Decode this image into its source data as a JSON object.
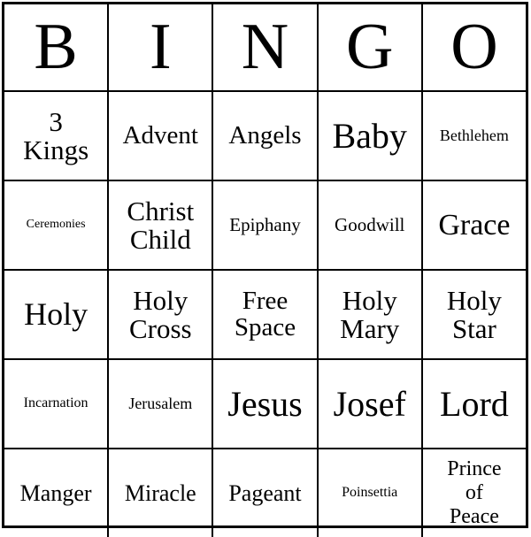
{
  "card": {
    "type": "bingo-card",
    "theme": "Christmas",
    "columns": 5,
    "rows": 5,
    "header": {
      "letters": [
        "B",
        "I",
        "N",
        "G",
        "O"
      ]
    },
    "grid": [
      [
        {
          "text": "3\nKings",
          "lines": [
            "3",
            "Kings"
          ],
          "size": "ml"
        },
        {
          "text": "Advent",
          "lines": [
            "Advent"
          ],
          "size": "md"
        },
        {
          "text": "Angels",
          "lines": [
            "Angels"
          ],
          "size": "md"
        },
        {
          "text": "Baby",
          "lines": [
            "Baby"
          ],
          "size": "xxl"
        },
        {
          "text": "Bethlehem",
          "lines": [
            "Bethlehem"
          ],
          "size": "tiny"
        }
      ],
      [
        {
          "text": "Ceremonies",
          "lines": [
            "Ceremonies"
          ],
          "size": "nano"
        },
        {
          "text": "Christ\nChild",
          "lines": [
            "Christ",
            "Child"
          ],
          "size": "ml"
        },
        {
          "text": "Epiphany",
          "lines": [
            "Epiphany"
          ],
          "size": "xxs"
        },
        {
          "text": "Goodwill",
          "lines": [
            "Goodwill"
          ],
          "size": "xxs"
        },
        {
          "text": "Grace",
          "lines": [
            "Grace"
          ],
          "size": "lg"
        }
      ],
      [
        {
          "text": "Holy",
          "lines": [
            "Holy"
          ],
          "size": "xl"
        },
        {
          "text": "Holy\nCross",
          "lines": [
            "Holy",
            "Cross"
          ],
          "size": "ml"
        },
        {
          "text": "Free\nSpace",
          "lines": [
            "Free",
            "Space"
          ],
          "size": "md"
        },
        {
          "text": "Holy\nMary",
          "lines": [
            "Holy",
            "Mary"
          ],
          "size": "ml"
        },
        {
          "text": "Holy\nStar",
          "lines": [
            "Holy",
            "Star"
          ],
          "size": "ml"
        }
      ],
      [
        {
          "text": "Incarnation",
          "lines": [
            "Incarnation"
          ],
          "size": "mini"
        },
        {
          "text": "Jerusalem",
          "lines": [
            "Jerusalem"
          ],
          "size": "tiny"
        },
        {
          "text": "Jesus",
          "lines": [
            "Jesus"
          ],
          "size": "xxl"
        },
        {
          "text": "Josef",
          "lines": [
            "Josef"
          ],
          "size": "xxl"
        },
        {
          "text": "Lord",
          "lines": [
            "Lord"
          ],
          "size": "xxl"
        }
      ],
      [
        {
          "text": "Manger",
          "lines": [
            "Manger"
          ],
          "size": "sm"
        },
        {
          "text": "Miracle",
          "lines": [
            "Miracle"
          ],
          "size": "sm"
        },
        {
          "text": "Pageant",
          "lines": [
            "Pageant"
          ],
          "size": "sm"
        },
        {
          "text": "Poinsettia",
          "lines": [
            "Poinsettia"
          ],
          "size": "mini"
        },
        {
          "text": "Prince\nof\nPeace",
          "lines": [
            "Prince",
            "of",
            "Peace"
          ],
          "size": "xs"
        }
      ]
    ],
    "colors": {
      "ink": "#000000",
      "paper": "#ffffff",
      "border": "#000000"
    }
  }
}
